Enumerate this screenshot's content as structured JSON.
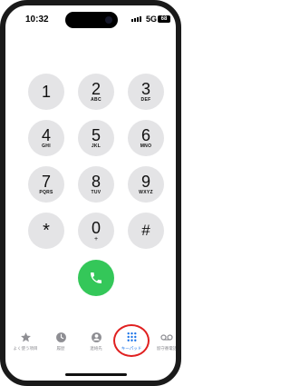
{
  "status": {
    "time": "10:32",
    "network": "5G",
    "battery": "68"
  },
  "keypad": [
    {
      "digit": "1",
      "letters": ""
    },
    {
      "digit": "2",
      "letters": "ABC"
    },
    {
      "digit": "3",
      "letters": "DEF"
    },
    {
      "digit": "4",
      "letters": "GHI"
    },
    {
      "digit": "5",
      "letters": "JKL"
    },
    {
      "digit": "6",
      "letters": "MNO"
    },
    {
      "digit": "7",
      "letters": "PQRS"
    },
    {
      "digit": "8",
      "letters": "TUV"
    },
    {
      "digit": "9",
      "letters": "WXYZ"
    },
    {
      "digit": "*",
      "letters": ""
    },
    {
      "digit": "0",
      "letters": "+"
    },
    {
      "digit": "#",
      "letters": ""
    }
  ],
  "call_button": {
    "icon": "phone-icon",
    "color": "#34c759"
  },
  "tabs": [
    {
      "label": "よく使う項目",
      "icon": "star-icon"
    },
    {
      "label": "履歴",
      "icon": "clock-icon"
    },
    {
      "label": "連絡先",
      "icon": "person-icon"
    },
    {
      "label": "キーパッド",
      "icon": "keypad-icon",
      "active": true
    },
    {
      "label": "留守番電話",
      "icon": "voicemail-icon"
    }
  ],
  "colors": {
    "key_bg": "#e4e4e6",
    "active_tab": "#1a73e8",
    "highlight": "#e02020"
  }
}
